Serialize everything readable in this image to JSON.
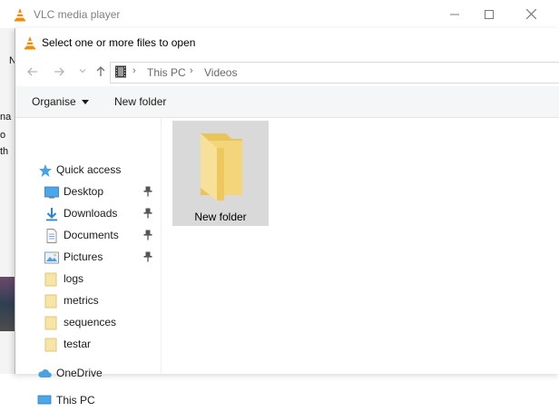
{
  "vlc": {
    "title": "VLC media player",
    "menu_fragments": [
      "N",
      "na",
      "o",
      "th"
    ]
  },
  "dialog": {
    "title": "Select one or more files to open"
  },
  "address": {
    "icon": "film-icon",
    "segments": [
      "This PC",
      "Videos"
    ]
  },
  "toolbar": {
    "organise_label": "Organise",
    "new_folder_label": "New folder"
  },
  "nav": {
    "items": [
      {
        "label": "Quick access",
        "icon": "star-icon"
      },
      {
        "label": "Desktop",
        "icon": "desktop-icon",
        "pinned": true
      },
      {
        "label": "Downloads",
        "icon": "download-icon",
        "pinned": true
      },
      {
        "label": "Documents",
        "icon": "document-icon",
        "pinned": true
      },
      {
        "label": "Pictures",
        "icon": "picture-icon",
        "pinned": true
      },
      {
        "label": "logs",
        "icon": "folder-icon"
      },
      {
        "label": "metrics",
        "icon": "folder-icon"
      },
      {
        "label": "sequences",
        "icon": "folder-icon"
      },
      {
        "label": "testar",
        "icon": "folder-icon"
      },
      {
        "label": "OneDrive",
        "icon": "cloud-icon"
      },
      {
        "label": "This PC",
        "icon": "computer-icon"
      }
    ]
  },
  "files": [
    {
      "name": "New folder",
      "icon": "folder-icon",
      "selected": true
    }
  ],
  "colors": {
    "folder": "#f3d57a",
    "selection": "#d9d9d9",
    "vlc_orange": "#f48b00"
  }
}
